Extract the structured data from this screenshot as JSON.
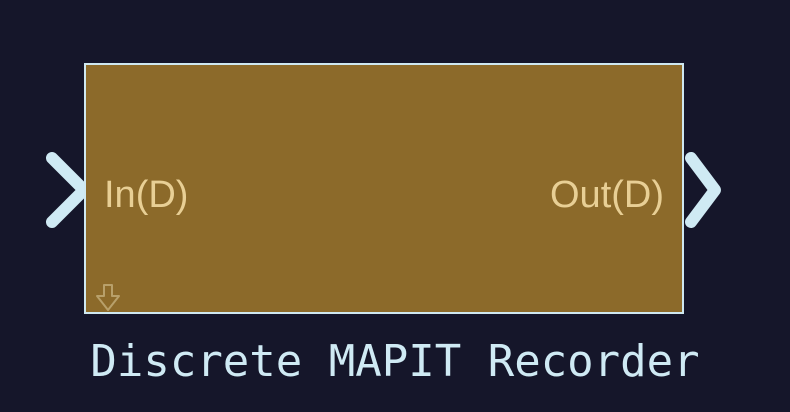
{
  "block": {
    "name": "Discrete MAPIT Recorder",
    "input_port": "In(D)",
    "output_port": "Out(D)"
  },
  "colors": {
    "background": "#15162a",
    "block_fill": "#8c6a2a",
    "block_border": "#cfe8f0",
    "port_text": "#e8cf95",
    "port_arrow": "#cfeaf4",
    "name_text": "#cfeaf4"
  },
  "icons": {
    "input_port": "chevron-right-icon",
    "output_port": "chevron-right-icon",
    "mask": "down-arrow-icon"
  }
}
